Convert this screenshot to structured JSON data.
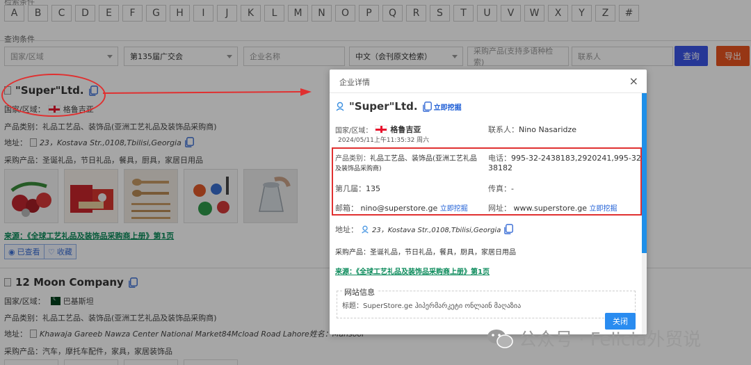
{
  "letters": [
    "A",
    "B",
    "C",
    "D",
    "E",
    "F",
    "G",
    "H",
    "I",
    "J",
    "K",
    "L",
    "M",
    "N",
    "O",
    "P",
    "Q",
    "R",
    "S",
    "T",
    "U",
    "V",
    "W",
    "X",
    "Y",
    "Z",
    "#"
  ],
  "top_cut_label": "检索条件",
  "query": {
    "label": "查询条件",
    "country_placeholder": "国家/区域",
    "fair_value": "第135届广交会",
    "company_placeholder": "企业名称",
    "language_value": "中文（会刊原文检索）",
    "product_placeholder": "采购产品(支持多语种检索)",
    "contact_placeholder": "联系人",
    "query_button": "查询",
    "export_button": "导出"
  },
  "cards": [
    {
      "name": "\"Super\"Ltd.",
      "country_label": "国家/区域：",
      "country": "格鲁吉亚",
      "category_line": "产品类别：礼品工艺品、装饰品(亚洲工艺礼品及装饰品采购商)",
      "address_label": "地址：",
      "address": "23，Kostava Str.,0108,Tbilisi,Georgia",
      "purchase_line": "采购产品：圣诞礼品，节日礼品，餐具，厨具，家居日用品",
      "source": "来源：《全球工艺礼品及装饰品采购商上册》第1页",
      "viewed_label": "已查看",
      "fav_label": "收藏"
    },
    {
      "name": "12 Moon Company",
      "country_label": "国家/区域：",
      "country": "巴基斯坦",
      "category_line": "产品类别：礼品工艺品、装饰品(亚洲工艺礼品及装饰品采购商)",
      "address_label": "地址：",
      "address": "Khawaja Gareeb Nawza Center National Market84Mcload Road Lahore姓名：Mansoor",
      "purchase_line": "采购产品：汽车，摩托车配件，家具，家居装饰品"
    }
  ],
  "modal": {
    "title": "企业详情",
    "close_icon": "×",
    "company_name": "\"Super\"Ltd.",
    "mine_link": "立即挖掘",
    "country_label": "国家/区域：",
    "country": "格鲁吉亚",
    "date": "2024/05/11上午11:35:32 周六",
    "contact_label": "联系人：",
    "contact": "Nino Nasaridze",
    "category_label": "产品类别：",
    "category_line1": "礼品工艺品、装饰品(亚洲工艺礼品",
    "category_line2": "及装饰品采购商)",
    "phone_label": "电话：",
    "phone_line1": "995-32-2438183,2920241,995-32-24",
    "phone_line2": "38182",
    "session_label": "第几届：",
    "session": "135",
    "fax_label": "传真：",
    "fax": "-",
    "email_label": "邮箱：",
    "email": "nino@superstore.ge",
    "email_link": "立即挖掘",
    "website_label": "网址：",
    "website": "www.superstore.ge",
    "website_link": "立即挖掘",
    "address_label": "地址：",
    "address": "23，Kostava Str.,0108,Tbilisi,Georgia",
    "purchase_line": "采购产品：圣诞礼品，节日礼品，餐具，厨具，家居日用品",
    "source": "来源：《全球工艺礼品及装饰品采购商上册》第1页",
    "web_info_title": "网站信息",
    "web_info_line": "标题：SuperStore.ge ჰიპერმარკეტი ონლაინ მაღაზია",
    "close_button": "关闭"
  },
  "watermark": {
    "text": "公众号 · Felicia外贸说"
  },
  "colors": {
    "primary_blue": "#3b55e6",
    "export_orange": "#e8531f",
    "annotation_red": "#e03030",
    "link_green": "#0a8a5a",
    "modal_button": "#2a8cf0"
  }
}
